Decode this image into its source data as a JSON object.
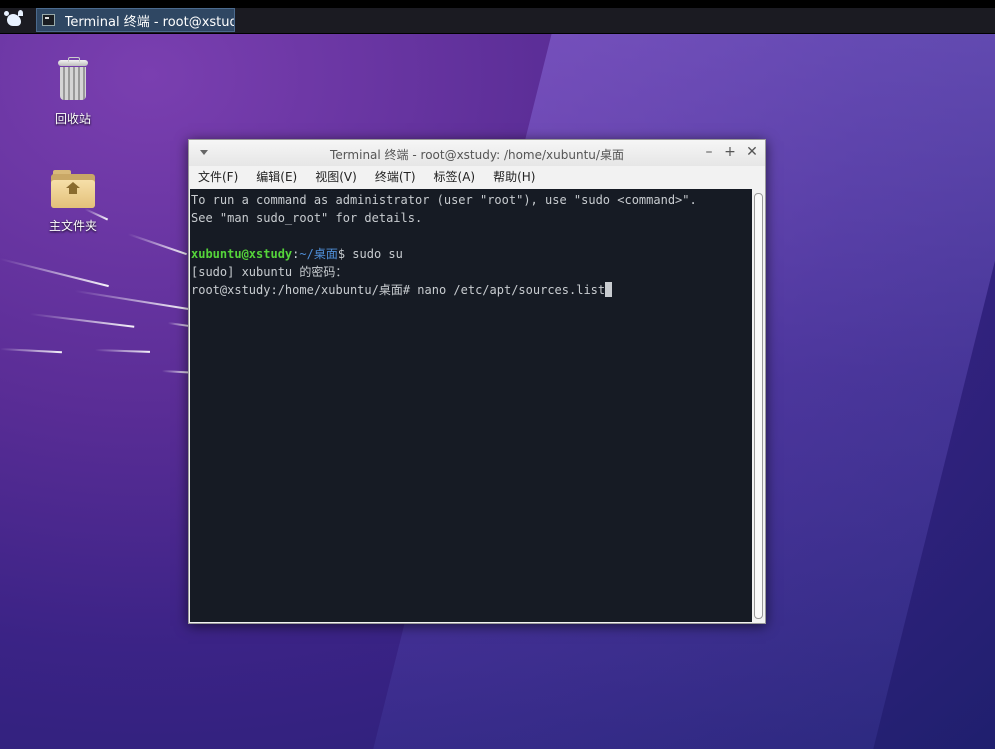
{
  "panel": {
    "taskbar_label": "Terminal 终端 - root@xstudy..."
  },
  "desktop": {
    "icons": [
      {
        "label": "回收站"
      },
      {
        "label": "主文件夹"
      }
    ]
  },
  "terminal": {
    "title": "Terminal 终端 - root@xstudy: /home/xubuntu/桌面",
    "menus": [
      "文件(F)",
      "编辑(E)",
      "视图(V)",
      "终端(T)",
      "标签(A)",
      "帮助(H)"
    ],
    "lines": {
      "l1": "To run a command as administrator (user \"root\"), use \"sudo <command>\".",
      "l2": "See \"man sudo_root\" for details.",
      "l4_user": "xubuntu@xstudy",
      "l4_sep": ":",
      "l4_path": "~/桌面",
      "l4_cmd": "$ sudo su",
      "l5": "[sudo] xubuntu 的密码：",
      "l6": "root@xstudy:/home/xubuntu/桌面# nano /etc/apt/sources.list"
    }
  }
}
